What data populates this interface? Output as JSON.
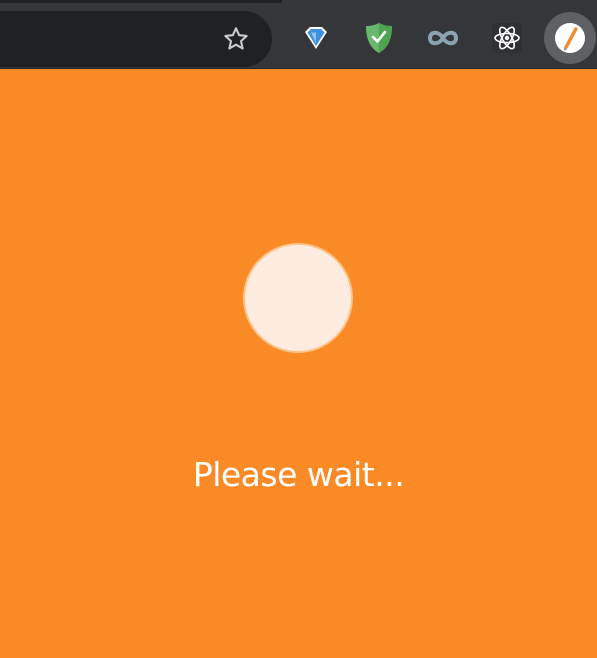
{
  "browser": {
    "toolbar": {
      "bookmark_icon": "star-outline-icon",
      "extensions": [
        {
          "name": "diamond-extension",
          "icon": "blue-diamond-icon",
          "color": "#4a90e2"
        },
        {
          "name": "adguard-extension",
          "icon": "green-shield-check-icon",
          "color": "#5cb85c"
        },
        {
          "name": "infinity-extension",
          "icon": "infinity-icon",
          "color": "#8ba3b0"
        },
        {
          "name": "react-devtools-extension",
          "icon": "react-atom-icon",
          "color": "#ffffff"
        }
      ],
      "profile_icon": "profile-avatar-icon"
    }
  },
  "page": {
    "background_color": "#f98a25",
    "loader_color": "#ffece0",
    "status_text": "Please wait..."
  }
}
